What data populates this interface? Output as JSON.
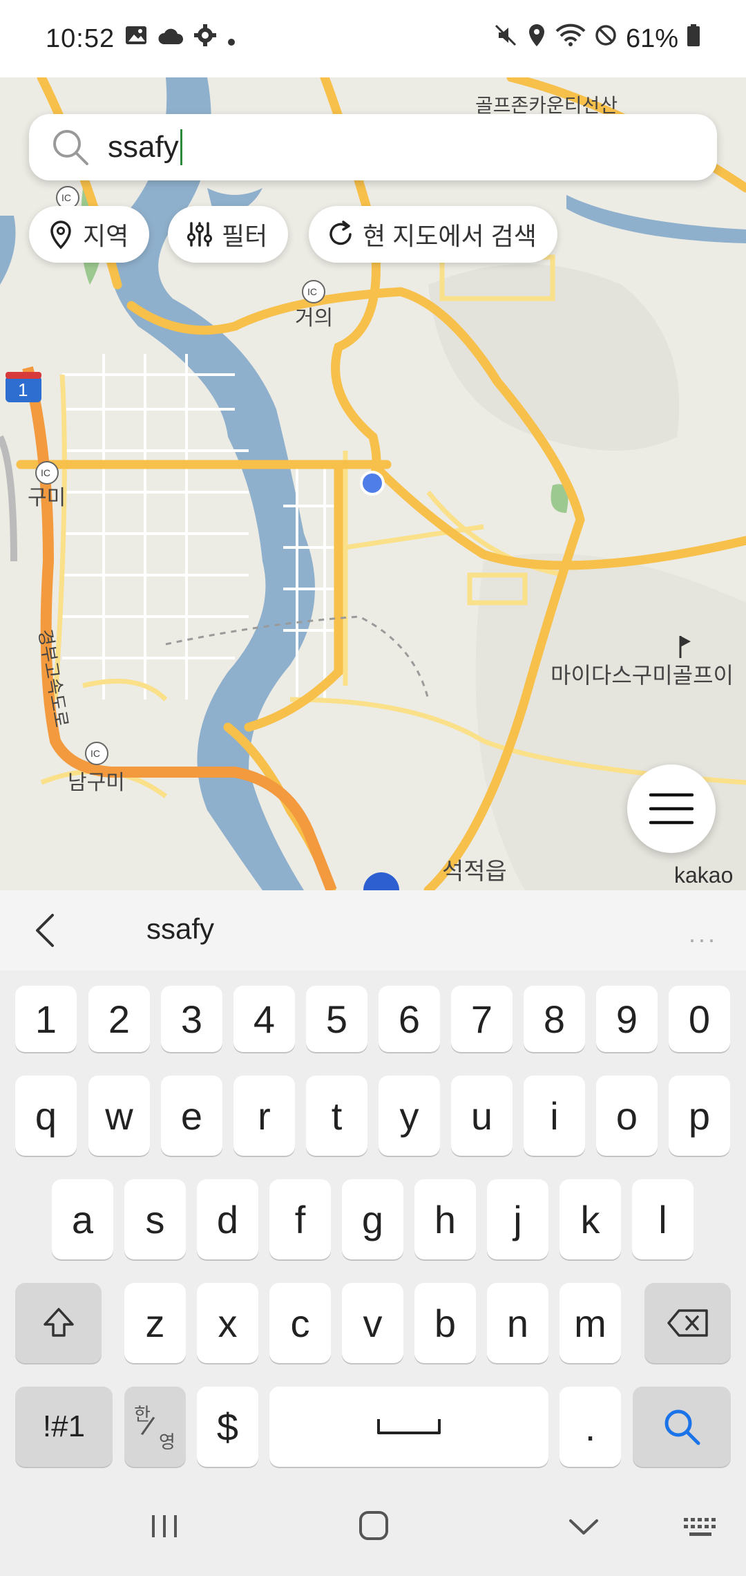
{
  "status_bar": {
    "time": "10:52",
    "battery": "61%",
    "icons_left": [
      "image-icon",
      "cloud-icon",
      "gear-icon",
      "dot-icon"
    ],
    "icons_right": [
      "mute-icon",
      "location-icon",
      "wifi-icon",
      "dnd-icon",
      "battery-icon"
    ]
  },
  "search": {
    "value": "ssafy"
  },
  "chips": {
    "region": "지역",
    "filter": "필터",
    "search_here": "현 지도에서 검색"
  },
  "map": {
    "labels": {
      "geoui": "거의",
      "gumi": "구미",
      "namgumi": "남구미",
      "seokjeok": "석적읍",
      "golf": "마이다스구미골프이",
      "expressway": "경부고속도로",
      "route_no": "1",
      "top_label": "골프존카운티선산",
      "ic": "IC"
    },
    "attribution": "kakao"
  },
  "suggestion_bar": {
    "word": "ssafy",
    "more": "···"
  },
  "keyboard": {
    "row_numbers": [
      "1",
      "2",
      "3",
      "4",
      "5",
      "6",
      "7",
      "8",
      "9",
      "0"
    ],
    "row1": [
      "q",
      "w",
      "e",
      "r",
      "t",
      "y",
      "u",
      "i",
      "o",
      "p"
    ],
    "row2": [
      "a",
      "s",
      "d",
      "f",
      "g",
      "h",
      "j",
      "k",
      "l"
    ],
    "row3": [
      "z",
      "x",
      "c",
      "v",
      "b",
      "n",
      "m"
    ],
    "symbols_key": "!#1",
    "lang_key_top": "한",
    "lang_key_bottom": "영",
    "dollar_key": "$",
    "period_key": "."
  },
  "colors": {
    "road_major": "#f7c04a",
    "expressway": "#f29a3d",
    "river": "#8fb0cc",
    "accent_blue": "#1a73e8",
    "cursor": "#2d8a3a"
  }
}
